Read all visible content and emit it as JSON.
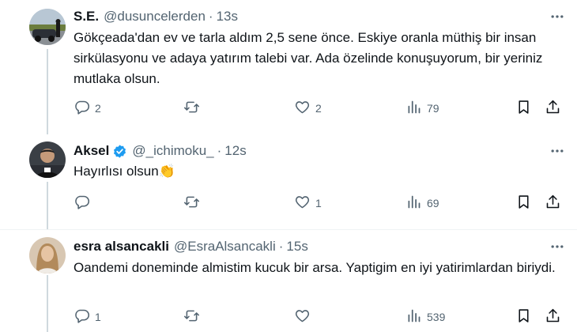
{
  "tweets": [
    {
      "name": "S.E.",
      "handle": "@dusuncelerden",
      "separator": "·",
      "time": "13s",
      "text": "Gökçeada'dan ev ve tarla aldım 2,5 sene önce. Eskiye oranla müthiş bir insan sirkülasyonu ve adaya yatırım talebi var. Ada özelinde konuşuyorum, bir yeriniz mutlaka olsun.",
      "replies": "2",
      "retweets": "",
      "likes": "2",
      "views": "79"
    },
    {
      "name": "Aksel",
      "handle": "@_ichimoku_",
      "separator": "·",
      "time": "12s",
      "verified": true,
      "text": "Hayırlısı olsun👏",
      "replies": "",
      "retweets": "",
      "likes": "1",
      "views": "69"
    },
    {
      "name": "esra alsancakli",
      "handle": "@EsraAlsancakli",
      "separator": "·",
      "time": "15s",
      "text": "Oandemi doneminde almistim kucuk bir arsa. Yaptigim en iyi yatirimlardan biriydi.",
      "replies": "1",
      "retweets": "",
      "likes": "",
      "views": "539"
    }
  ],
  "icons": {
    "reply": "reply-icon",
    "retweet": "retweet-icon",
    "like": "like-icon",
    "views": "views-icon",
    "bookmark": "bookmark-icon",
    "share": "share-icon",
    "more": "more-icon",
    "verified": "verified-badge-icon"
  },
  "colors": {
    "text": "#0f1419",
    "secondary": "#536471",
    "verified": "#1d9bf0",
    "thread_line": "#cfd9de",
    "divider": "#eff3f4"
  }
}
